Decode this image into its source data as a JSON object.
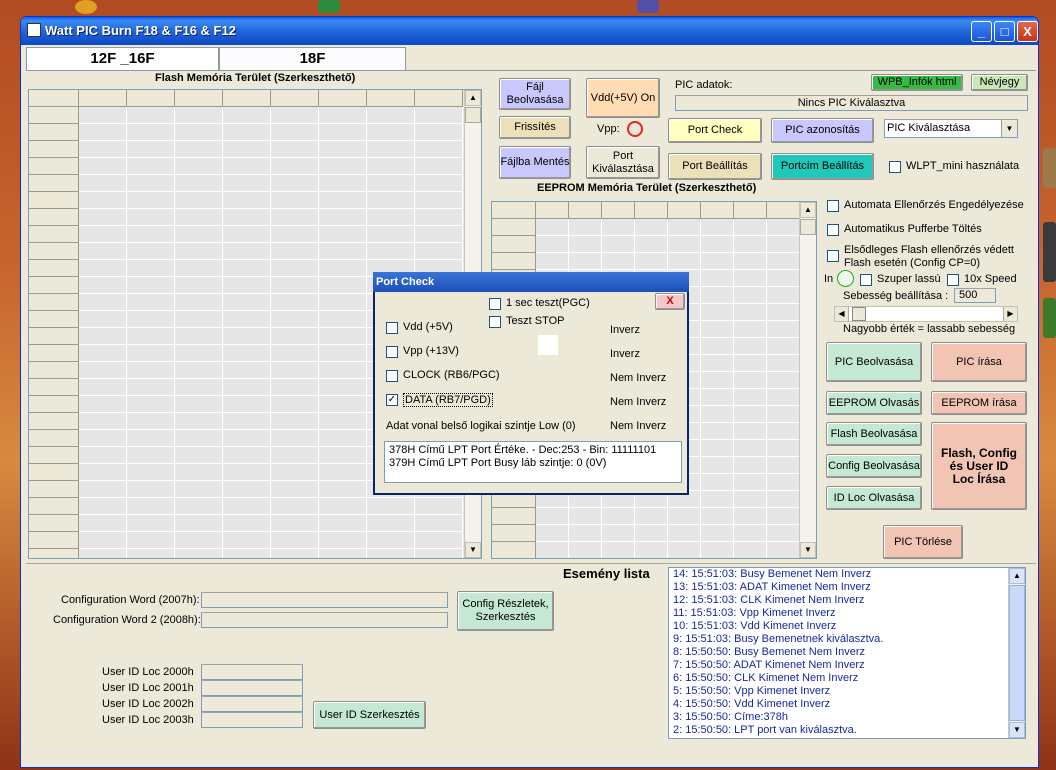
{
  "window": {
    "title": "Watt PIC Burn F18 & F16 & F12",
    "min": "_",
    "max": "□",
    "close": "X"
  },
  "tabs": [
    "12F _16F",
    "18F"
  ],
  "flash": {
    "title": "Flash Memória Terület (Szerkeszthető)"
  },
  "eeprom": {
    "title": "EEPROM Memória Terület (Szerkeszthető)"
  },
  "buttons": {
    "file_read": "Fájl Beolvasása",
    "vdd_on": "Vdd(+5V) On",
    "refresh": "Frissítés",
    "vpp_label": "Vpp:",
    "port_check": "Port Check",
    "pic_id": "PIC azonosítás",
    "save_file": "Fájlba Mentés",
    "port_select": "Port Kiválasztása",
    "port_settings": "Port Beállítás",
    "port_addr_settings": "Portcím Beállítás",
    "wpb_info": "WPB_Infók html",
    "about": "Névjegy",
    "pic_read": "PIC Beolvasása",
    "pic_write": "PIC írása",
    "eeprom_read": "EEPROM Olvasás",
    "eeprom_write": "EEPROM írása",
    "flash_read": "Flash Beolvasása",
    "config_read": "Config Beolvasása",
    "idloc_read": "ID Loc Olvasása",
    "flash_config_write": "Flash, Config és User ID Loc Írása",
    "pic_erase": "PIC Törlése",
    "config_edit": "Config Részletek, Szerkesztés",
    "userid_edit": "User ID Szerkesztés"
  },
  "pic": {
    "label": "PIC adatok:",
    "status": "Nincs PIC Kiválasztva",
    "select": "PIC Kiválasztása"
  },
  "options": {
    "wlpt": "WLPT_mini használata",
    "auto_verify": "Automata Ellenőrzés Engedélyezése",
    "auto_buffer": "Automatikus Pufferbe Töltés",
    "primary_flash": "Elsődleges Flash ellenőrzés védett Flash esetén (Config CP=0)",
    "in_label": "In",
    "super_slow": "Szuper lassú",
    "x10": "10x Speed",
    "speed_label": "Sebesség beállítása :",
    "speed_value": "500",
    "speed_hint": "Nagyobb érték = lassabb sebesség",
    "speed_slider": 0.02
  },
  "config": {
    "word1_label": "Configuration Word (2007h):",
    "word2_label": "Configuration Word 2 (2008h):",
    "uid0": "User ID Loc 2000h",
    "uid1": "User ID Loc 2001h",
    "uid2": "User ID Loc 2002h",
    "uid3": "User ID Loc 2003h"
  },
  "events": {
    "title": "Esemény lista",
    "items": [
      "14:  15:51:03:  Busy Bemenet Nem Inverz",
      "13:  15:51:03:  ADAT Kimenet Nem Inverz",
      "12:  15:51:03:  CLK Kimenet Nem Inverz",
      "11:  15:51:03:  Vpp Kimenet Inverz",
      "10:  15:51:03:  Vdd Kimenet Inverz",
      "9:  15:51:03:  Busy Bemenetnek kiválasztva.",
      "8:  15:50:50:  Busy Bemenet Nem Inverz",
      "7:  15:50:50:  ADAT Kimenet Nem Inverz",
      "6:  15:50:50:  CLK Kimenet Nem Inverz",
      "5:  15:50:50:  Vpp Kimenet Inverz",
      "4:  15:50:50:  Vdd Kimenet Inverz",
      "3:  15:50:50:  Címe:378h",
      "2:  15:50:50:  LPT port van kiválasztva."
    ]
  },
  "dialog": {
    "title": "Port Check",
    "close": "X",
    "test_1sec": "1 sec teszt(PGC)",
    "test_stop": "Teszt STOP",
    "vdd": "Vdd (+5V)",
    "vpp": "Vpp (+13V)",
    "clock": "CLOCK (RB6/PGC)",
    "data": "DATA (RB7/PGD)",
    "vdd_state": "Inverz",
    "vpp_state": "Inverz",
    "clock_state": "Nem Inverz",
    "data_state": "Nem Inverz",
    "low_label": "Adat vonal belső logikai szintje Low (0)",
    "low_state": "Nem Inverz",
    "data_checked": "✓",
    "info1": "378H Című LPT Port Értéke. - Dec:253 - Bin: 11111101",
    "info2": "379H Című LPT Port Busy láb szintje: 0 (0V)"
  },
  "colors": {
    "purple_btn": "#c8c8ff",
    "peach_btn": "#ffdcb4",
    "yellow_btn": "#ffffc0",
    "tan_btn": "#ece0b8",
    "teal_btn": "#1fc8b8",
    "green_btn": "#c4e8d2",
    "salmon_btn": "#f2c4b4",
    "wpb_green": "#33bb44",
    "about_green": "#c8e8b8"
  }
}
